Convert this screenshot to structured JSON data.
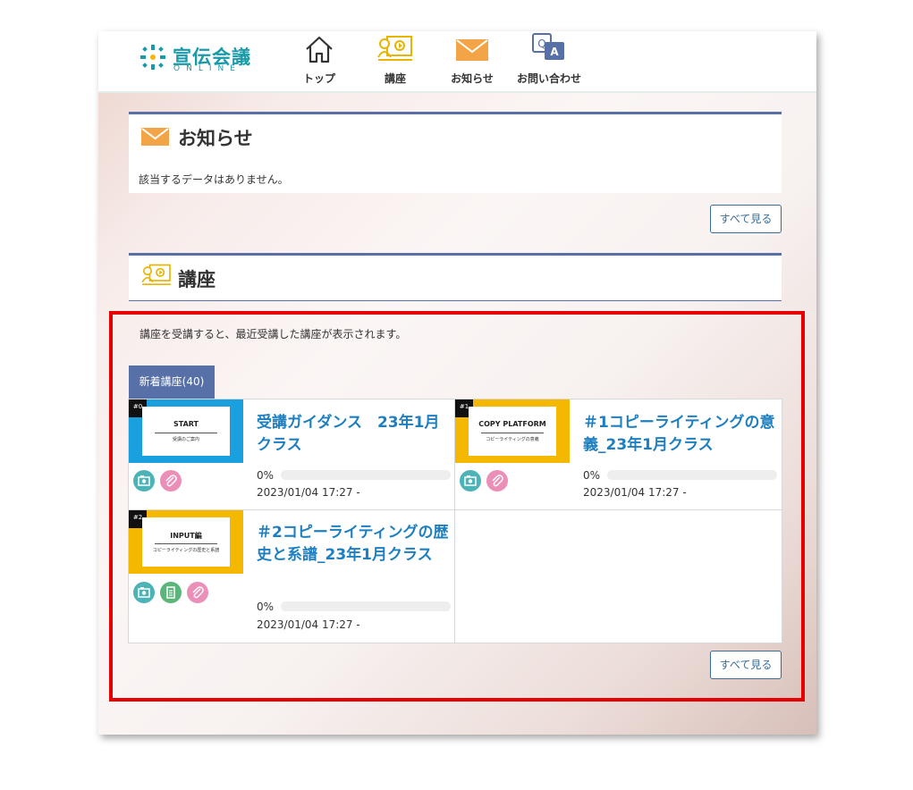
{
  "brand": {
    "name": "宣伝会議",
    "sub": "ONLINE",
    "color": "#1a9aa8"
  },
  "nav": [
    {
      "label": "トップ",
      "icon": "home-icon"
    },
    {
      "label": "講座",
      "icon": "lecture-icon"
    },
    {
      "label": "お知らせ",
      "icon": "mail-icon"
    },
    {
      "label": "お問い合わせ",
      "icon": "qa-icon"
    }
  ],
  "notices": {
    "title": "お知らせ",
    "empty_text": "該当するデータはありません。",
    "see_all": "すべて見る"
  },
  "courses": {
    "title": "講座",
    "description": "講座を受講すると、最近受講した講座が表示されます。",
    "tab_label": "新着講座(40)",
    "see_all": "すべて見る",
    "items": [
      {
        "number": "#0",
        "thumb_title": "START",
        "thumb_sub": "受講のご案内",
        "thumb_color": "#1aa0de",
        "title": "受講ガイダンス　23年1月クラス",
        "progress_text": "0%",
        "progress": 0,
        "date": "2023/01/04 17:27 -",
        "icons": [
          "video-icon",
          "clip-icon"
        ]
      },
      {
        "number": "#1",
        "thumb_title": "COPY PLATFORM",
        "thumb_sub": "コピーライティングの意義",
        "thumb_color": "#f5b800",
        "title": "＃1コピーライティングの意義_23年1月クラス",
        "progress_text": "0%",
        "progress": 0,
        "date": "2023/01/04 17:27 -",
        "icons": [
          "video-icon",
          "clip-icon"
        ]
      },
      {
        "number": "#2",
        "thumb_title": "INPUT編",
        "thumb_sub": "コピーライティングの歴史と系譜",
        "thumb_color": "#f5b800",
        "title": "＃2コピーライティングの歴史と系譜_23年1月クラス",
        "progress_text": "0%",
        "progress": 0,
        "date": "2023/01/04 17:27 -",
        "icons": [
          "video-icon",
          "document-icon",
          "clip-icon"
        ]
      }
    ]
  },
  "colors": {
    "accent_blue": "#5770a7",
    "link_blue": "#1d7fc0",
    "highlight_red": "#e60000",
    "video_icon_bg": "#4db3b7",
    "document_icon_bg": "#5cb57a",
    "clip_icon_bg": "#ec8fb8"
  }
}
